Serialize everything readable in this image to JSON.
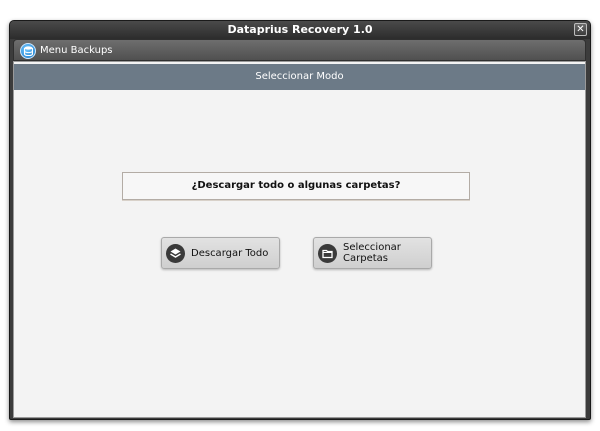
{
  "window": {
    "title": "Dataprius Recovery 1.0",
    "close_label": "✕"
  },
  "menubar": {
    "backups_label": "Menu Backups",
    "backups_icon": "database-icon"
  },
  "mode": {
    "header": "Seleccionar Modo",
    "question": "¿Descargar todo o algunas carpetas?",
    "download_all_label": "Descargar Todo",
    "download_all_icon": "layers-icon",
    "select_folders_label": "Seleccionar Carpetas",
    "select_folders_icon": "folder-icon"
  },
  "colors": {
    "header_bar": "#6c7a87",
    "window_chrome": "#3c3c3c",
    "content_bg": "#f3f3f3",
    "accent_blue": "#1f7ac8"
  }
}
